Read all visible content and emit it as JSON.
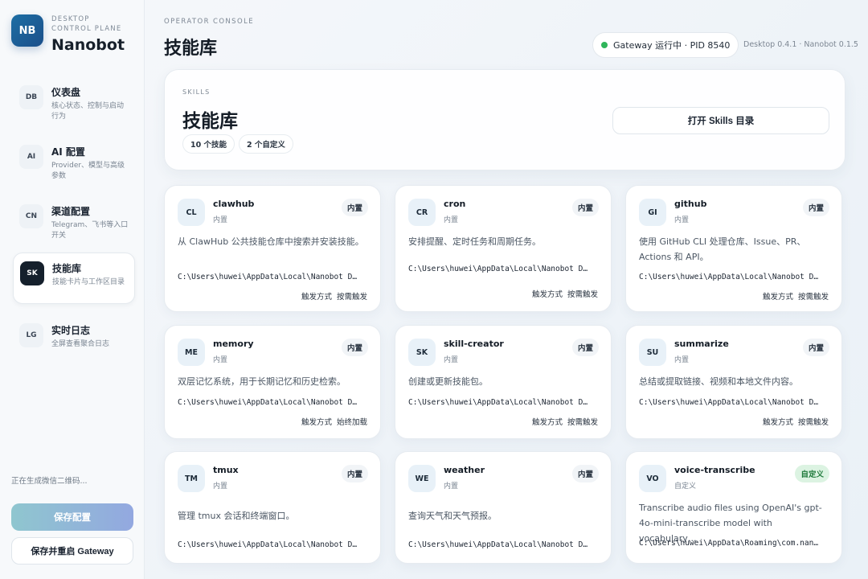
{
  "brand": {
    "logo": "NB",
    "subtitle": "DESKTOP CONTROL PLANE",
    "name": "Nanobot"
  },
  "nav": [
    {
      "badge": "DB",
      "title": "仪表盘",
      "desc": "核心状态、控制与启动行为"
    },
    {
      "badge": "AI",
      "title": "AI 配置",
      "desc": "Provider、模型与高级参数"
    },
    {
      "badge": "CN",
      "title": "渠道配置",
      "desc": "Telegram、飞书等入口开关"
    },
    {
      "badge": "SK",
      "title": "技能库",
      "desc": "技能卡片与工作区目录"
    },
    {
      "badge": "LG",
      "title": "实时日志",
      "desc": "全屏查看聚合日志"
    }
  ],
  "sidebar_status": "正在生成微信二维码...",
  "buttons": {
    "save": "保存配置",
    "save_restart": "保存并重启 Gateway",
    "open_skills": "打开 Skills 目录"
  },
  "header": {
    "eyebrow": "OPERATOR CONSOLE",
    "title": "技能库",
    "gateway_status": "Gateway 运行中 · PID 8540",
    "status_color": "#2fb55a",
    "version": "Desktop 0.4.1 · Nanobot 0.1.5"
  },
  "hero": {
    "eyebrow": "SKILLS",
    "title": "技能库",
    "count_skills": "10 个技能",
    "count_custom": "2 个自定义"
  },
  "trigger_label": "触发方式",
  "skills": [
    {
      "icon": "CL",
      "name": "clawhub",
      "source": "内置",
      "tag": "内置",
      "desc": "从 ClawHub 公共技能仓库中搜索并安装技能。",
      "path": "C:\\Users\\huwei\\AppData\\Local\\Nanobot D…",
      "trigger": "按需触发"
    },
    {
      "icon": "CR",
      "name": "cron",
      "source": "内置",
      "tag": "内置",
      "desc": "安排提醒、定时任务和周期任务。",
      "path": "C:\\Users\\huwei\\AppData\\Local\\Nanobot D…",
      "trigger": "按需触发"
    },
    {
      "icon": "GI",
      "name": "github",
      "source": "内置",
      "tag": "内置",
      "desc": "使用 GitHub CLI 处理仓库、Issue、PR、Actions 和 API。",
      "path": "C:\\Users\\huwei\\AppData\\Local\\Nanobot D…",
      "trigger": "按需触发"
    },
    {
      "icon": "ME",
      "name": "memory",
      "source": "内置",
      "tag": "内置",
      "desc": "双层记忆系统，用于长期记忆和历史检索。",
      "path": "C:\\Users\\huwei\\AppData\\Local\\Nanobot D…",
      "trigger": "始终加载"
    },
    {
      "icon": "SK",
      "name": "skill-creator",
      "source": "内置",
      "tag": "内置",
      "desc": "创建或更新技能包。",
      "path": "C:\\Users\\huwei\\AppData\\Local\\Nanobot D…",
      "trigger": "按需触发"
    },
    {
      "icon": "SU",
      "name": "summarize",
      "source": "内置",
      "tag": "内置",
      "desc": "总结或提取链接、视频和本地文件内容。",
      "path": "C:\\Users\\huwei\\AppData\\Local\\Nanobot D…",
      "trigger": "按需触发"
    },
    {
      "icon": "TM",
      "name": "tmux",
      "source": "内置",
      "tag": "内置",
      "desc": "管理 tmux 会话和终端窗口。",
      "path": "C:\\Users\\huwei\\AppData\\Local\\Nanobot D…",
      "trigger": ""
    },
    {
      "icon": "WE",
      "name": "weather",
      "source": "内置",
      "tag": "内置",
      "desc": "查询天气和天气预报。",
      "path": "C:\\Users\\huwei\\AppData\\Local\\Nanobot D…",
      "trigger": ""
    },
    {
      "icon": "VO",
      "name": "voice-transcribe",
      "source": "自定义",
      "tag": "自定义",
      "desc": "Transcribe audio files using OpenAI's gpt-4o-mini-transcribe model with vocabulary…",
      "path": "C:\\Users\\huwei\\AppData\\Roaming\\com.nan…",
      "trigger": ""
    }
  ]
}
